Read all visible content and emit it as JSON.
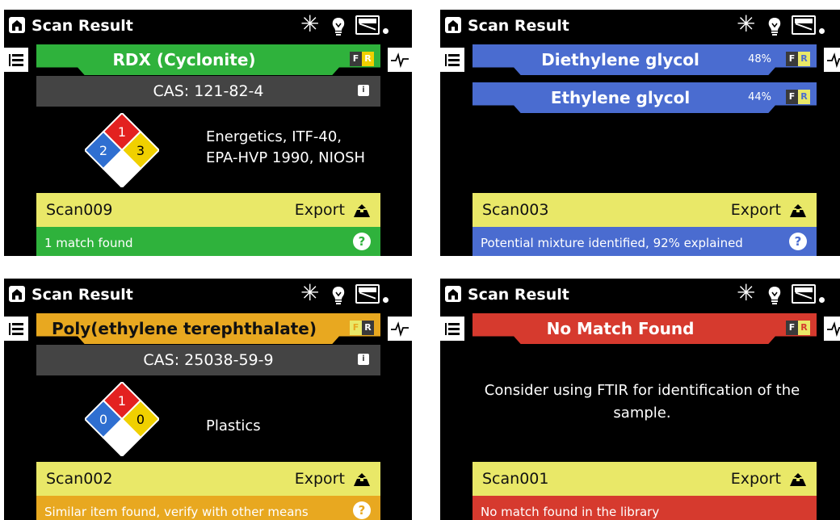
{
  "colors": {
    "green": "#2fb23c",
    "blue": "#4a6cd0",
    "orange": "#e8a820",
    "red": "#d63a2e",
    "scan_yellow": "#e9e868",
    "cas_gray": "#444444",
    "nfpa_red": "#e32120",
    "nfpa_blue": "#2f6fd1",
    "nfpa_yellow": "#f0d000"
  },
  "screens": [
    {
      "title": "Scan Result",
      "banners": [
        {
          "name": "RDX (Cyclonite)",
          "fr_r_color": "#f0d000"
        }
      ],
      "cas": "CAS: 121-82-4",
      "nfpa": {
        "health": "2",
        "flammability": "1",
        "reactivity": "3"
      },
      "hazard_lines": [
        "Energetics, ITF-40,",
        "EPA-HVP 1990, NIOSH"
      ],
      "scan_id": "Scan009",
      "export_label": "Export",
      "status_text": "1 match found",
      "help_icon": "?",
      "theme": "green"
    },
    {
      "title": "Scan Result",
      "banners": [
        {
          "name": "Diethylene glycol",
          "percent": "48%"
        },
        {
          "name": "Ethylene glycol",
          "percent": "44%"
        }
      ],
      "scan_id": "Scan003",
      "export_label": "Export",
      "status_text": "Potential mixture identified, 92% explained",
      "help_icon": "?",
      "theme": "blue"
    },
    {
      "title": "Scan Result",
      "banners": [
        {
          "name": "Poly(ethylene terephthalate)"
        }
      ],
      "cas": "CAS: 25038-59-9",
      "nfpa": {
        "health": "0",
        "flammability": "1",
        "reactivity": "0"
      },
      "hazard_lines": [
        "Plastics"
      ],
      "scan_id": "Scan002",
      "export_label": "Export",
      "status_text": "Similar item found, verify with other means",
      "help_icon": "?",
      "theme": "orange"
    },
    {
      "title": "Scan Result",
      "banners": [
        {
          "name": "No Match Found"
        }
      ],
      "message": "Consider using FTIR for identification of the sample.",
      "scan_id": "Scan001",
      "export_label": "Export",
      "status_text": "No match found in the library",
      "theme": "red"
    }
  ],
  "fr_labels": {
    "f": "F",
    "r": "R"
  },
  "info_icon": "i",
  "icons": [
    "home-icon",
    "brightness-icon",
    "bulb-icon",
    "battery-icon",
    "list-icon",
    "spectrum-icon",
    "export-icon",
    "info-icon",
    "help-icon"
  ]
}
